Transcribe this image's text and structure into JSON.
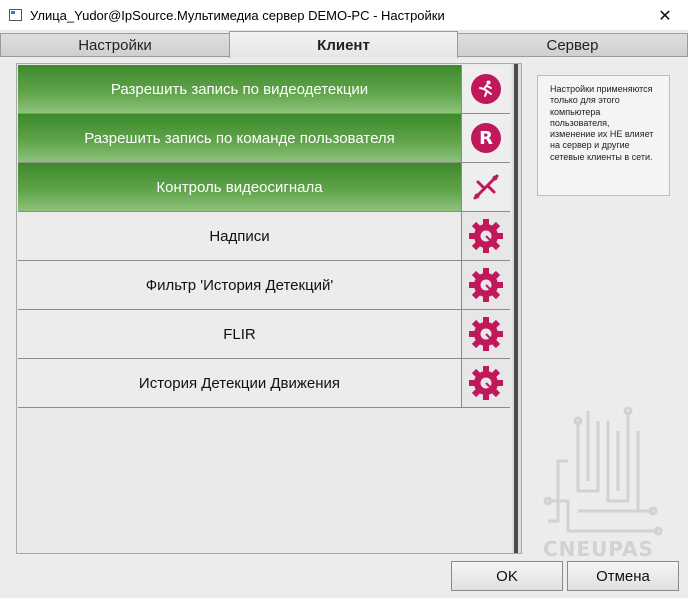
{
  "window": {
    "title": "Улица_Yudor@IpSource.Мультимедиа сервер DEMO-PC - Настройки",
    "close_glyph": "✕"
  },
  "tabs": [
    {
      "label": "Настройки",
      "active": false
    },
    {
      "label": "Клиент",
      "active": true
    },
    {
      "label": "Сервер",
      "active": false
    }
  ],
  "rows": [
    {
      "label": "Разрешить запись по видеодетекции",
      "icon": "running-man-icon",
      "style": "green"
    },
    {
      "label": "Разрешить запись по команде пользователя",
      "icon": "record-r-icon",
      "style": "green"
    },
    {
      "label": "Контроль видеосигнала",
      "icon": "signal-loss-icon",
      "style": "green"
    },
    {
      "label": "Надписи",
      "icon": "gear-icon",
      "style": "grey"
    },
    {
      "label": "Фильтр 'История Детекций'",
      "icon": "gear-icon",
      "style": "grey"
    },
    {
      "label": "FLIR",
      "icon": "gear-icon",
      "style": "grey"
    },
    {
      "label": "История Детекции Движения",
      "icon": "gear-icon",
      "style": "grey"
    }
  ],
  "info": {
    "text": "Настройки применяются только для этого компьютера пользователя, изменение их НЕ влияет на сервер и другие сетевые клиенты в сети."
  },
  "watermark": {
    "text": "CNEUPAS"
  },
  "buttons": {
    "ok": "OK",
    "cancel": "Отмена"
  },
  "colors": {
    "accent_green": "#4e9a3c",
    "icon_magenta": "#c0185a"
  }
}
